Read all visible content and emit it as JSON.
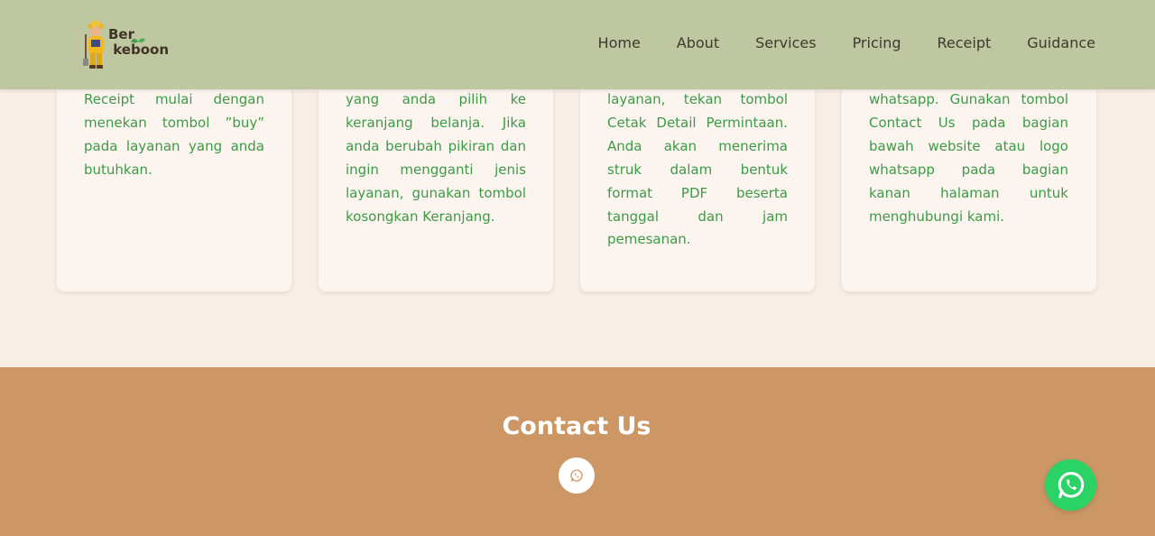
{
  "header": {
    "logo_text": "Ber\n keboon",
    "nav": [
      {
        "label": "Home"
      },
      {
        "label": "About"
      },
      {
        "label": "Services"
      },
      {
        "label": "Pricing"
      },
      {
        "label": "Receipt"
      },
      {
        "label": "Guidance"
      }
    ]
  },
  "cards": [
    {
      "text": "Receipt mulai dengan menekan tombol ”buy” pada layanan yang anda butuhkan."
    },
    {
      "text": "yang anda pilih ke keranjang belanja. Jika anda berubah pikiran dan ingin mengganti jenis layanan, gunakan tombol kosongkan Keranjang."
    },
    {
      "text": "layanan, tekan tombol Cetak Detail Permintaan. Anda akan menerima struk dalam bentuk format PDF beserta tanggal dan jam pemesanan."
    },
    {
      "text": "whatsapp. Gunakan tombol Contact Us pada bagian bawah website atau logo whatsapp pada bagian kanan halaman untuk menghubungi kami."
    }
  ],
  "contact": {
    "title": "Contact Us"
  },
  "colors": {
    "header_bg": "#bec79f",
    "page_bg": "#f8eee6",
    "card_text": "#3d9b48",
    "contact_bg": "#cc9765",
    "whatsapp_green": "#2bd366"
  },
  "icons": {
    "contact_icon": "whatsapp-icon",
    "floating_icon": "whatsapp-icon"
  }
}
